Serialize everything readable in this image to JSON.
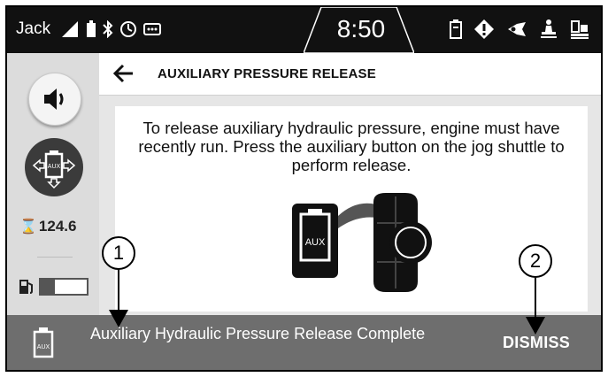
{
  "status_bar": {
    "user": "Jack",
    "time": "8:50",
    "left_icons": [
      "signal-icon",
      "battery-icon",
      "bluetooth-icon",
      "gauge-icon",
      "more-icon"
    ],
    "right_icons": [
      "aux-status-icon",
      "warning-diamond-icon",
      "pedal-icon",
      "operator-seat-icon",
      "machine-icon"
    ]
  },
  "sidebar": {
    "sound_button_icon": "speaker-icon",
    "aux_button_icon": "aux-hydraulic-icon",
    "hours_symbol": "⌛",
    "hours": "124.6",
    "fuel_icon": "fuel-pump-icon",
    "fuel_level": 0.3
  },
  "header": {
    "back_icon": "back-arrow-icon",
    "title": "AUXILIARY PRESSURE RELEASE"
  },
  "content": {
    "instructions": "To release auxiliary hydraulic pressure, engine must have recently run. Press the auxiliary button on the jog shuttle to perform release.",
    "aux_label": "AUX"
  },
  "toast": {
    "icon_label": "AUX",
    "message": "Auxiliary Hydraulic Pressure Release Complete",
    "dismiss_label": "DISMISS"
  },
  "callouts": {
    "one": "1",
    "two": "2"
  },
  "colors": {
    "status_bar_bg": "#111111",
    "sidebar_bg": "#dcdcdc",
    "toast_bg": "#6e6e6e",
    "aux_button_bg": "#3b3b3b"
  }
}
